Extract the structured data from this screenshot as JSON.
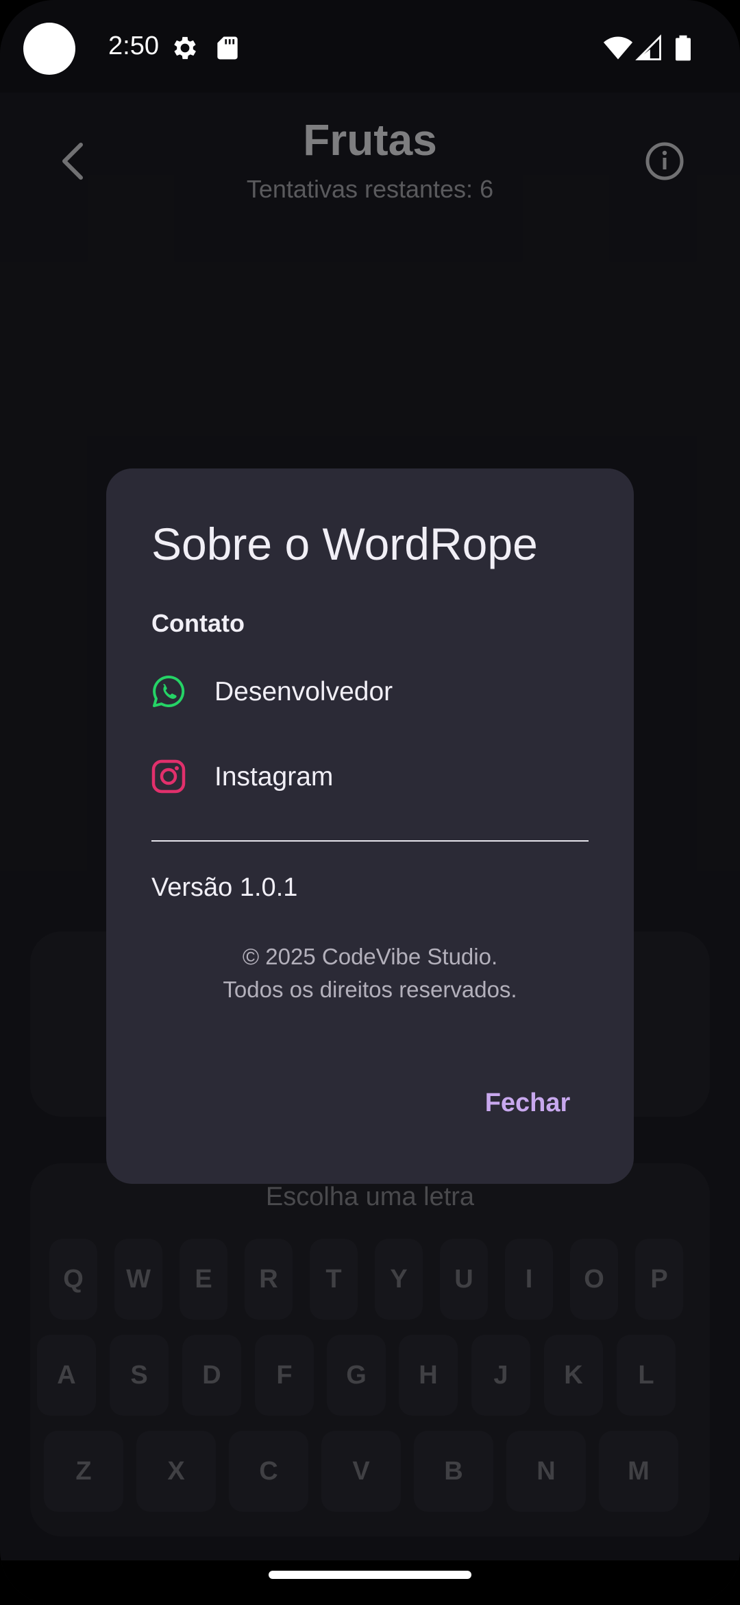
{
  "status_bar": {
    "time": "2:50"
  },
  "header": {
    "title": "Frutas",
    "subtitle": "Tentativas restantes: 6"
  },
  "keyboard": {
    "title": "Escolha uma letra",
    "rows": [
      [
        "Q",
        "W",
        "E",
        "R",
        "T",
        "Y",
        "U",
        "I",
        "O",
        "P"
      ],
      [
        "A",
        "S",
        "D",
        "F",
        "G",
        "H",
        "J",
        "K",
        "L"
      ],
      [
        "Z",
        "X",
        "C",
        "V",
        "B",
        "N",
        "M"
      ]
    ]
  },
  "dialog": {
    "title": "Sobre o WordRope",
    "section_label": "Contato",
    "contacts": [
      {
        "label": "Desenvolvedor",
        "icon": "whatsapp-icon"
      },
      {
        "label": "Instagram",
        "icon": "instagram-icon"
      }
    ],
    "version": "Versão 1.0.1",
    "copyright_line1": "© 2025 CodeVibe Studio.",
    "copyright_line2": "Todos os direitos reservados.",
    "close_label": "Fechar"
  },
  "colors": {
    "dialog_bg": "#2b2a36",
    "accent": "#c8a8ee",
    "whatsapp": "#25d366",
    "instagram": "#e1306c"
  }
}
